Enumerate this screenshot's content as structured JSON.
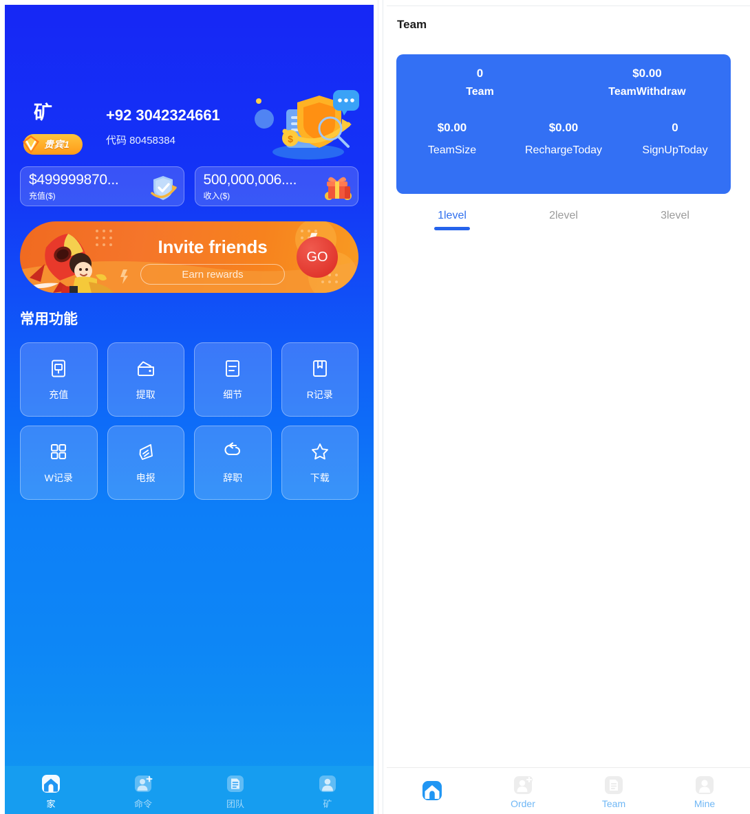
{
  "left": {
    "profile": {
      "avatar_text": "矿",
      "vip_badge": "贵宾1",
      "vip_icon": "diamond-v-icon",
      "phone": "+92 3042324661",
      "invite_code": "代码 80458384",
      "hero_icon": "shield-coins-illustration"
    },
    "stats": [
      {
        "value": "$499999870...",
        "label": "充值($)",
        "icon": "shield-check-icon"
      },
      {
        "value": "500,000,006....",
        "label": "收入($)",
        "icon": "gift-box-icon"
      }
    ],
    "banner": {
      "title": "Invite friends",
      "subtitle": "Earn rewards",
      "button": "GO",
      "art_icon": "rocket-boy-illustration"
    },
    "section_title": "常用功能",
    "functions": [
      {
        "label": "充值",
        "icon": "recharge-icon"
      },
      {
        "label": "提取",
        "icon": "wallet-icon"
      },
      {
        "label": "细节",
        "icon": "details-icon"
      },
      {
        "label": "R记录",
        "icon": "book-record-icon"
      },
      {
        "label": "W记录",
        "icon": "grid-record-icon"
      },
      {
        "label": "电报",
        "icon": "telegram-icon"
      },
      {
        "label": "辞职",
        "icon": "undo-resign-icon"
      },
      {
        "label": "下载",
        "icon": "star-download-icon"
      }
    ],
    "nav": [
      {
        "label": "家",
        "icon": "home-icon",
        "active": true
      },
      {
        "label": "命令",
        "icon": "order-user-plus-icon",
        "active": false
      },
      {
        "label": "团队",
        "icon": "team-document-icon",
        "active": false
      },
      {
        "label": "矿",
        "icon": "mine-user-icon",
        "active": false
      }
    ]
  },
  "right": {
    "title": "Team",
    "card": {
      "top": [
        {
          "value": "0",
          "label": "Team"
        },
        {
          "value": "$0.00",
          "label": "TeamWithdraw"
        }
      ],
      "bottom": [
        {
          "value": "$0.00",
          "label": "TeamSize"
        },
        {
          "value": "$0.00",
          "label": "RechargeToday"
        },
        {
          "value": "0",
          "label": "SignUpToday"
        }
      ]
    },
    "tabs": [
      {
        "label": "1level",
        "active": true
      },
      {
        "label": "2level",
        "active": false
      },
      {
        "label": "3level",
        "active": false
      }
    ],
    "nav": [
      {
        "label": "",
        "icon": "home-icon",
        "active": true
      },
      {
        "label": "Order",
        "icon": "order-user-plus-icon",
        "active": false
      },
      {
        "label": "Team",
        "icon": "team-document-icon",
        "active": false
      },
      {
        "label": "Mine",
        "icon": "mine-user-icon",
        "active": false
      }
    ]
  },
  "colors": {
    "left_bg_top": "#1627f5",
    "left_bg_bottom": "#1298f1",
    "left_nav_bg": "#169df0",
    "team_card": "#3370f4",
    "tab_active": "#2563eb",
    "banner_orange": "#f5752a",
    "vip_gold": "#ffb01f"
  }
}
